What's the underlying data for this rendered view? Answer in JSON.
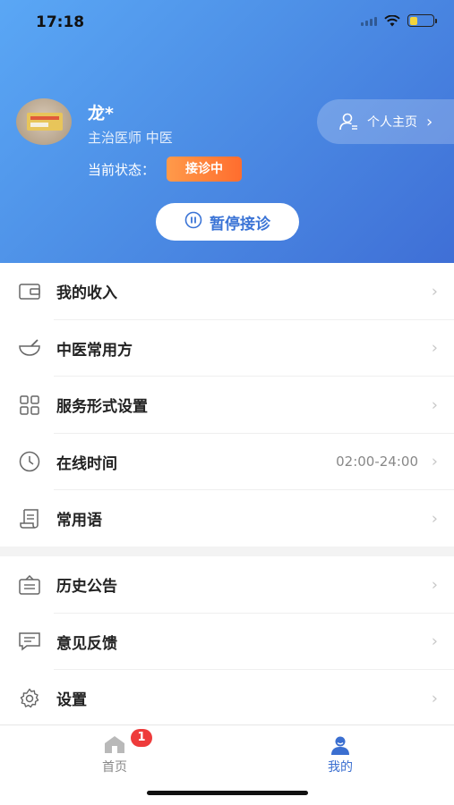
{
  "status_bar": {
    "time": "17:18"
  },
  "profile": {
    "name": "龙*",
    "title": "主治医师 中医",
    "status_label": "当前状态：",
    "status_value": "接诊中",
    "profile_link": "个人主页"
  },
  "pause_button": "暂停接诊",
  "menu_group_1": [
    {
      "label": "我的收入",
      "icon": "wallet-icon"
    },
    {
      "label": "中医常用方",
      "icon": "mortar-icon"
    },
    {
      "label": "服务形式设置",
      "icon": "grid-icon"
    },
    {
      "label": "在线时间",
      "icon": "clock-icon",
      "value": "02:00-24:00"
    },
    {
      "label": "常用语",
      "icon": "scroll-icon"
    }
  ],
  "menu_group_2": [
    {
      "label": "历史公告",
      "icon": "notice-icon"
    },
    {
      "label": "意见反馈",
      "icon": "feedback-icon"
    },
    {
      "label": "设置",
      "icon": "gear-icon"
    }
  ],
  "tabbar": {
    "home_label": "首页",
    "home_badge": "1",
    "mine_label": "我的"
  },
  "colors": {
    "header_gradient_start": "#5aa7f5",
    "header_gradient_end": "#3f6fd6",
    "status_badge": "#ff7a35",
    "active_tab": "#3b6fd0",
    "notification_badge": "#ee3b3b"
  }
}
